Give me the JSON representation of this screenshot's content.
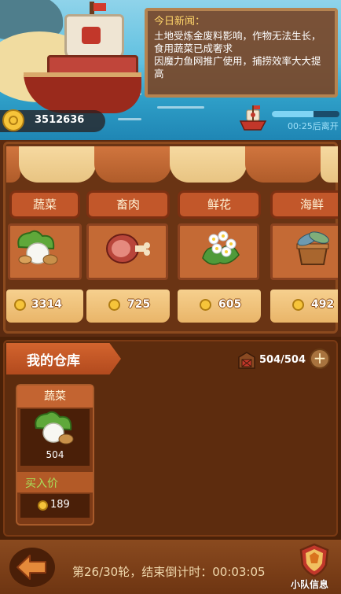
{
  "news": {
    "title": "今日新闻：",
    "body": "土地受炼金废料影响，作物无法生长，食用蔬菜已成奢求\n因魔力鱼网推广使用，捕捞效率大大提高"
  },
  "gold": {
    "value": "3512636",
    "icon": "gold-coin-icon"
  },
  "departure": {
    "countdown_text": "00:25后离开",
    "progress": 0.62,
    "icon": "ship-icon"
  },
  "market": {
    "stalls": [
      {
        "name": "蔬菜",
        "price": "3314",
        "icon": "vegetable-icon"
      },
      {
        "name": "畜肉",
        "price": "725",
        "icon": "meat-icon"
      },
      {
        "name": "鲜花",
        "price": "605",
        "icon": "flower-icon"
      },
      {
        "name": "海鲜",
        "price": "492",
        "icon": "seafood-icon"
      }
    ]
  },
  "warehouse": {
    "title": "我的仓库",
    "capacity": "504/504",
    "add_label": "+",
    "items": [
      {
        "name": "蔬菜",
        "qty": "504",
        "buy_label": "买入价",
        "buy_price": "189",
        "icon": "vegetable-icon"
      }
    ]
  },
  "footer": {
    "round_text": "第26/30轮，结束倒计时：00:03:05",
    "team_label": "小队信息",
    "back_icon": "back-arrow-icon",
    "team_icon": "team-shield-icon"
  },
  "colors": {
    "accent": "#c2572a",
    "gold": "#f6c43a",
    "panel": "#5d2c0e"
  }
}
